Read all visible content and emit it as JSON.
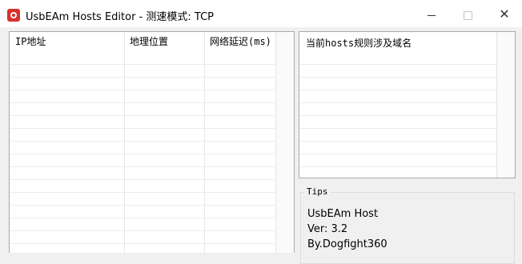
{
  "window": {
    "title": "UsbEAm Hosts Editor - 测速模式: TCP",
    "minimize_glyph": "",
    "close_glyph": "✕"
  },
  "ip_table": {
    "columns": [
      "IP地址",
      "地理位置",
      "网络延迟(ms)"
    ],
    "rows": []
  },
  "hosts_list": {
    "header": "当前hosts规则涉及域名",
    "items": []
  },
  "tips": {
    "legend": "Tips",
    "lines": [
      "UsbEAm Host",
      "Ver: 3.2",
      "By.Dogfight360"
    ]
  },
  "colors": {
    "app_icon": "#d9302c",
    "background": "#f0f0f0"
  }
}
